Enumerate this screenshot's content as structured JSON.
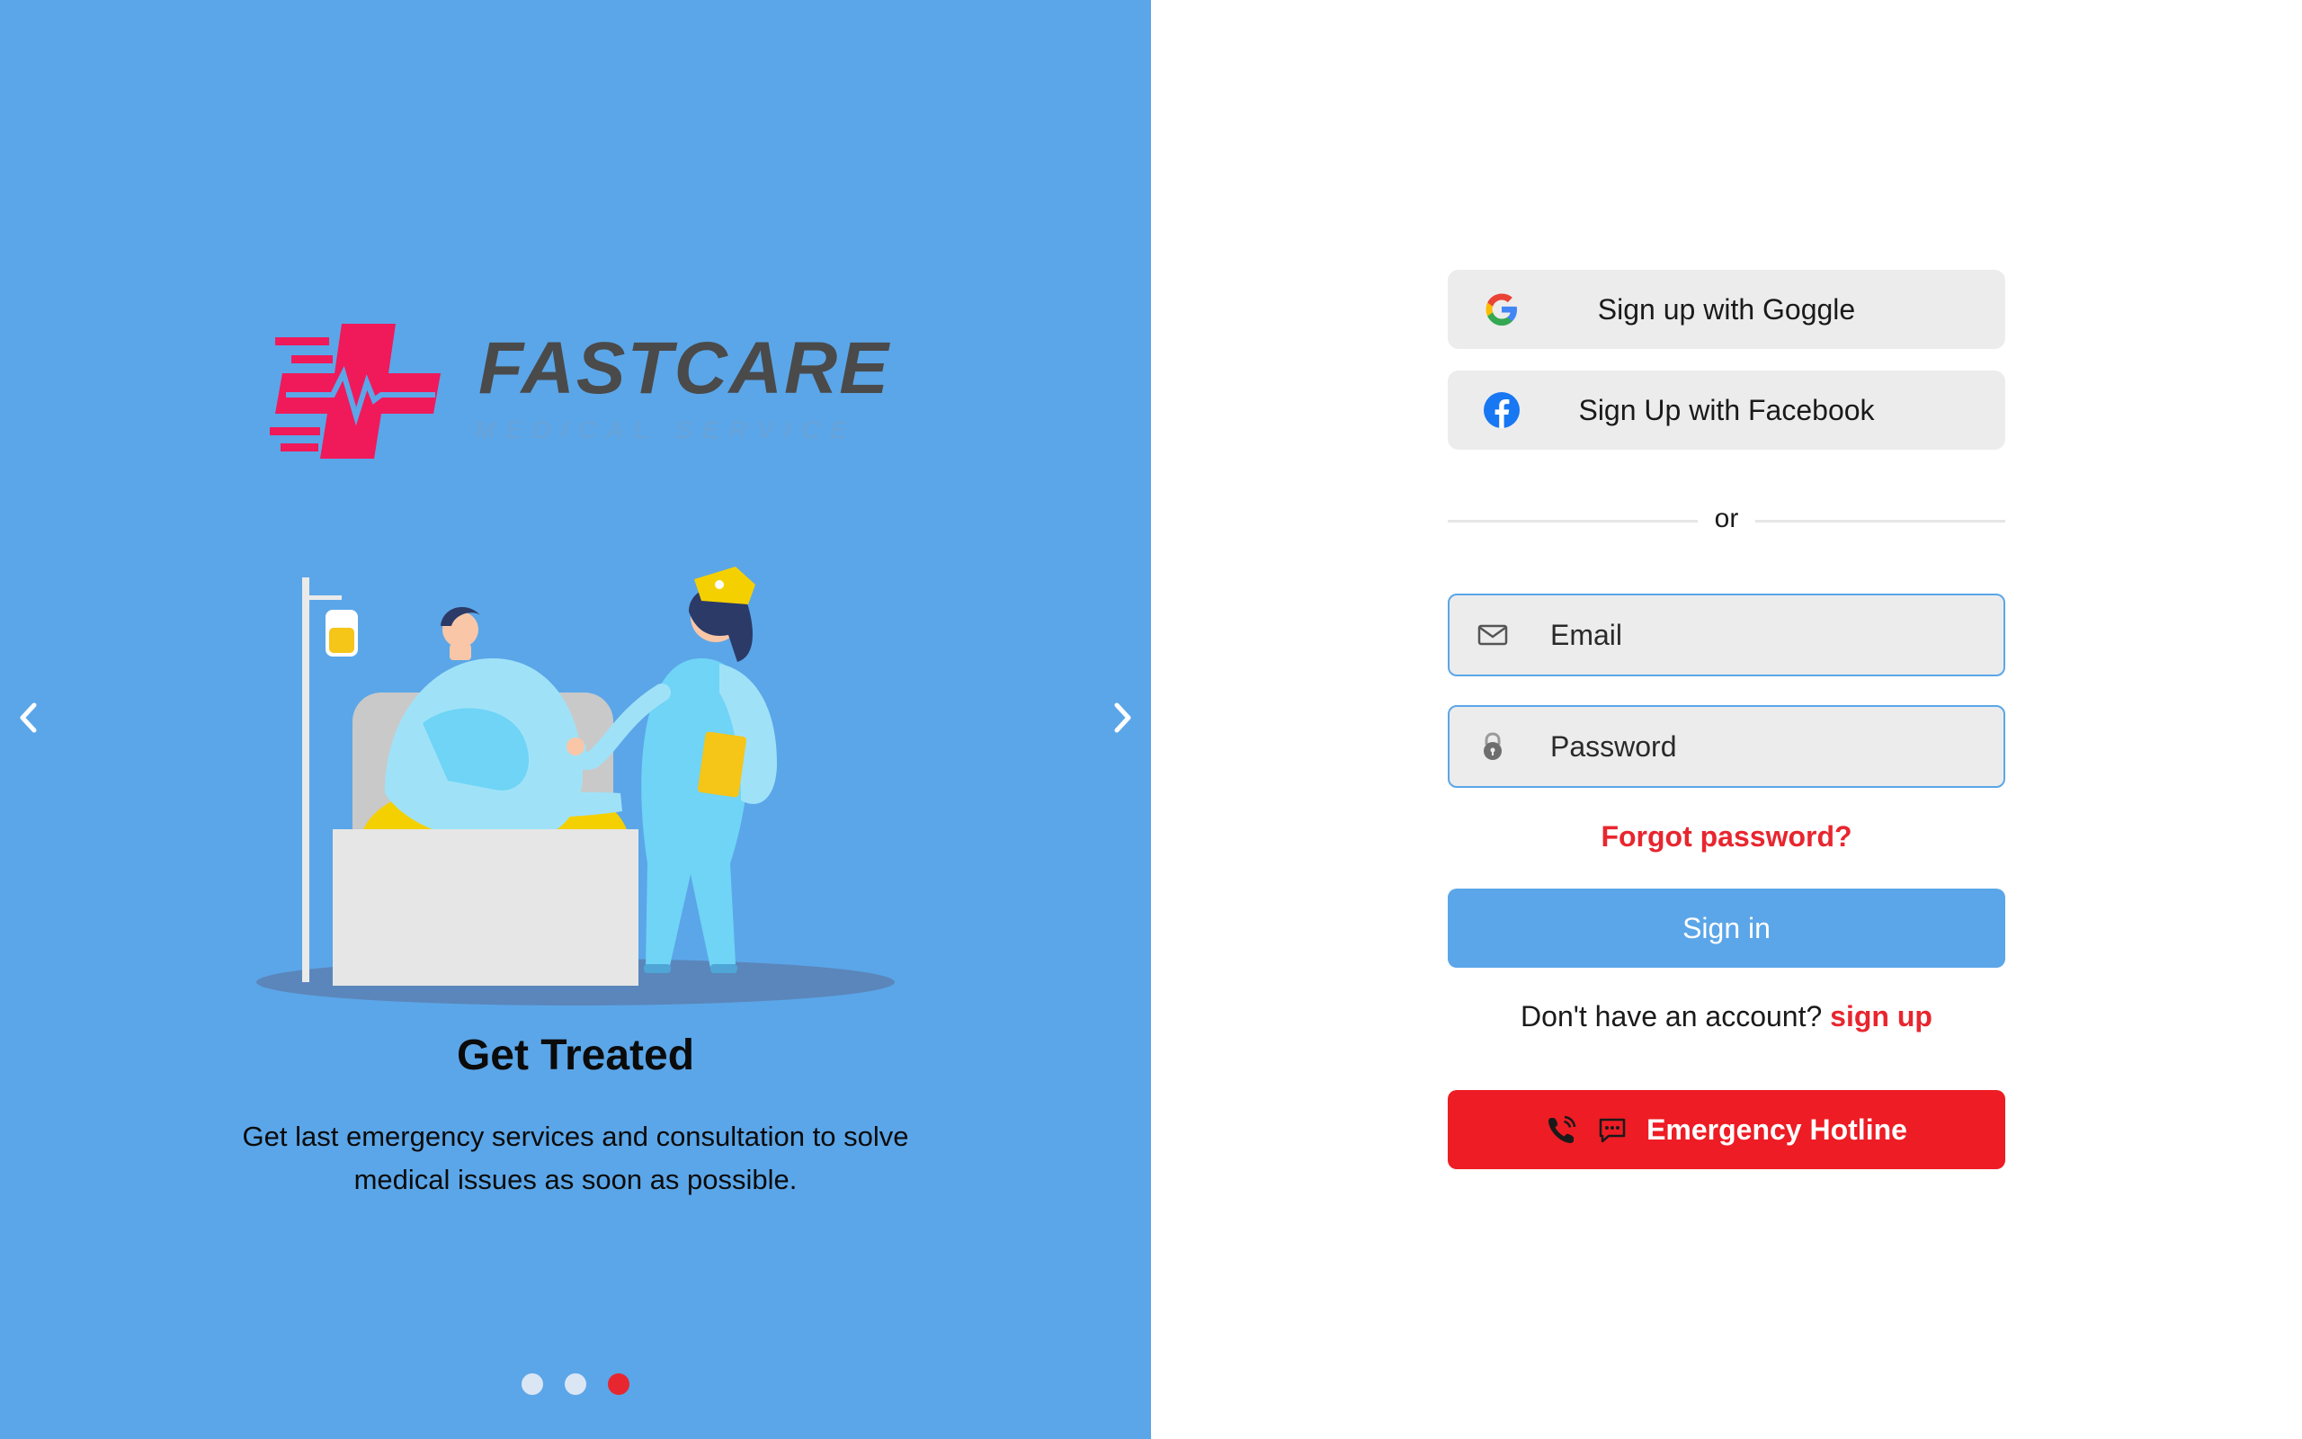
{
  "brand": {
    "name": "FASTCARE",
    "tagline": "MEDICAL SERVICE",
    "colors": {
      "panel": "#5ba6e8",
      "accent": "#e8262f",
      "emergency": "#ee1c24",
      "logo_red": "#f0195a"
    }
  },
  "carousel": {
    "prev_icon": "chevron-left-icon",
    "next_icon": "chevron-right-icon",
    "slide": {
      "title": "Get Treated",
      "description": "Get last emergency services and consultation to solve medical issues as soon as possible."
    },
    "dots": [
      {
        "active": false
      },
      {
        "active": false
      },
      {
        "active": true
      }
    ]
  },
  "auth": {
    "google_label": "Sign up with Goggle",
    "facebook_label": "Sign Up with Facebook",
    "divider_text": "or",
    "email_placeholder": "Email",
    "password_placeholder": "Password",
    "forgot_label": "Forgot password?",
    "signin_label": "Sign in",
    "no_account_text": "Don't have an account?",
    "signup_label": "sign up",
    "emergency_label": "Emergency Hotline"
  }
}
